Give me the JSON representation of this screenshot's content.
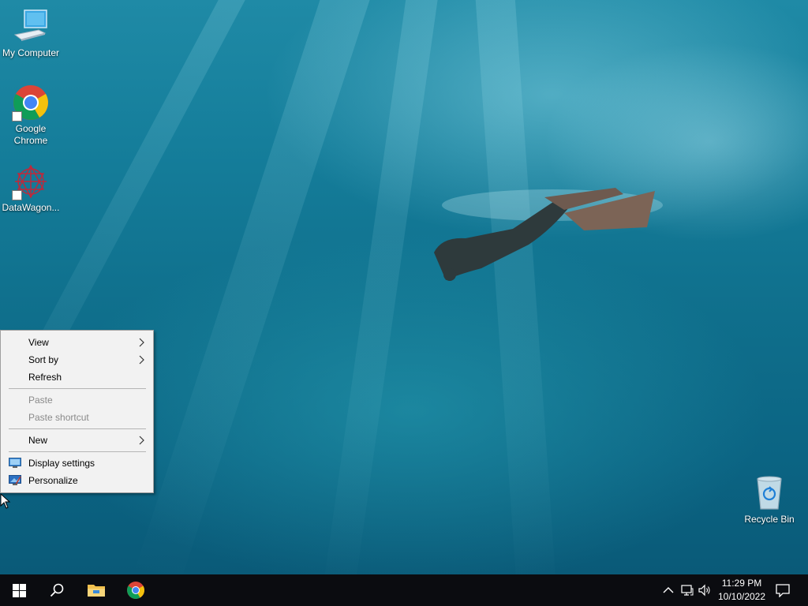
{
  "desktop": {
    "icons": [
      {
        "label": "My Computer",
        "icon": "computer-icon"
      },
      {
        "label": "Google\nChrome",
        "icon": "chrome-icon"
      },
      {
        "label": "DataWagon...",
        "icon": "datawagon-icon"
      },
      {
        "label": "Recycle Bin",
        "icon": "recycle-bin-icon"
      }
    ]
  },
  "context_menu": {
    "items": [
      {
        "label": "View",
        "has_submenu": true,
        "enabled": true
      },
      {
        "label": "Sort by",
        "has_submenu": true,
        "enabled": true
      },
      {
        "label": "Refresh",
        "has_submenu": false,
        "enabled": true
      },
      {
        "label": "Paste",
        "has_submenu": false,
        "enabled": false
      },
      {
        "label": "Paste shortcut",
        "has_submenu": false,
        "enabled": false
      },
      {
        "label": "New",
        "has_submenu": true,
        "enabled": true
      },
      {
        "label": "Display settings",
        "icon": "display-settings-icon",
        "enabled": true
      },
      {
        "label": "Personalize",
        "icon": "personalize-icon",
        "enabled": true
      }
    ]
  },
  "taskbar": {
    "pinned": [
      "start-icon",
      "search-icon",
      "file-explorer-icon",
      "chrome-icon"
    ],
    "tray_icons": [
      "chevron-up-icon",
      "network-icon",
      "volume-icon"
    ],
    "clock": {
      "time": "11:29 PM",
      "date": "10/10/2022"
    },
    "notification_icon": "action-center-icon"
  },
  "colors": {
    "taskbar": "#0b0c10",
    "menu_bg": "#f2f2f2",
    "disabled_text": "#8a8a8a",
    "accent": "#0078d7"
  }
}
